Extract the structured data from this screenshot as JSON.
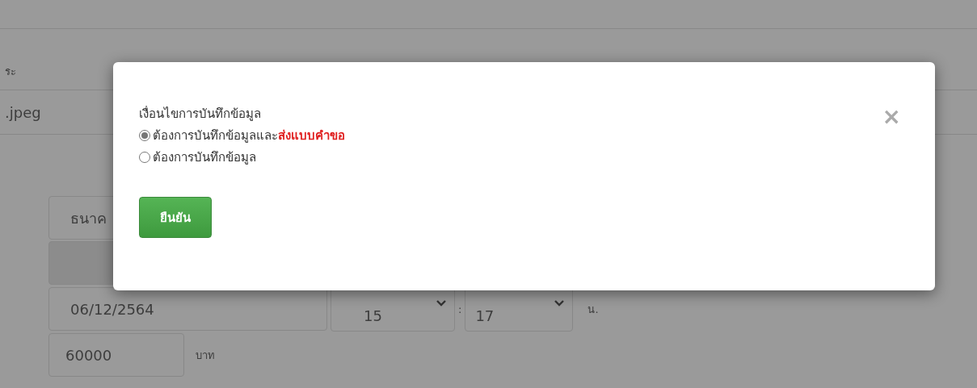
{
  "page": {
    "label": "ระ",
    "file_field": {
      "value": ".jpeg"
    },
    "bank_field": {
      "value": "ธนาค"
    },
    "date_field": {
      "value": "06/12/2564"
    },
    "hour_select": {
      "value": "15"
    },
    "time_separator": ":",
    "minute_select": {
      "value": "17"
    },
    "time_unit": "น.",
    "amount_field": {
      "value": "60000"
    },
    "currency": "บาท"
  },
  "dialog": {
    "title": "เงื่อนไขการบันทึกข้อมูล",
    "close": "×",
    "options": [
      {
        "label": "ต้องการบันทึกข้อมูลและ",
        "highlight": "ส่งแบบคำขอ",
        "selected": true
      },
      {
        "label": "ต้องการบันทึกข้อมูล",
        "selected": false
      }
    ],
    "confirm_button": "ยืนยัน"
  }
}
